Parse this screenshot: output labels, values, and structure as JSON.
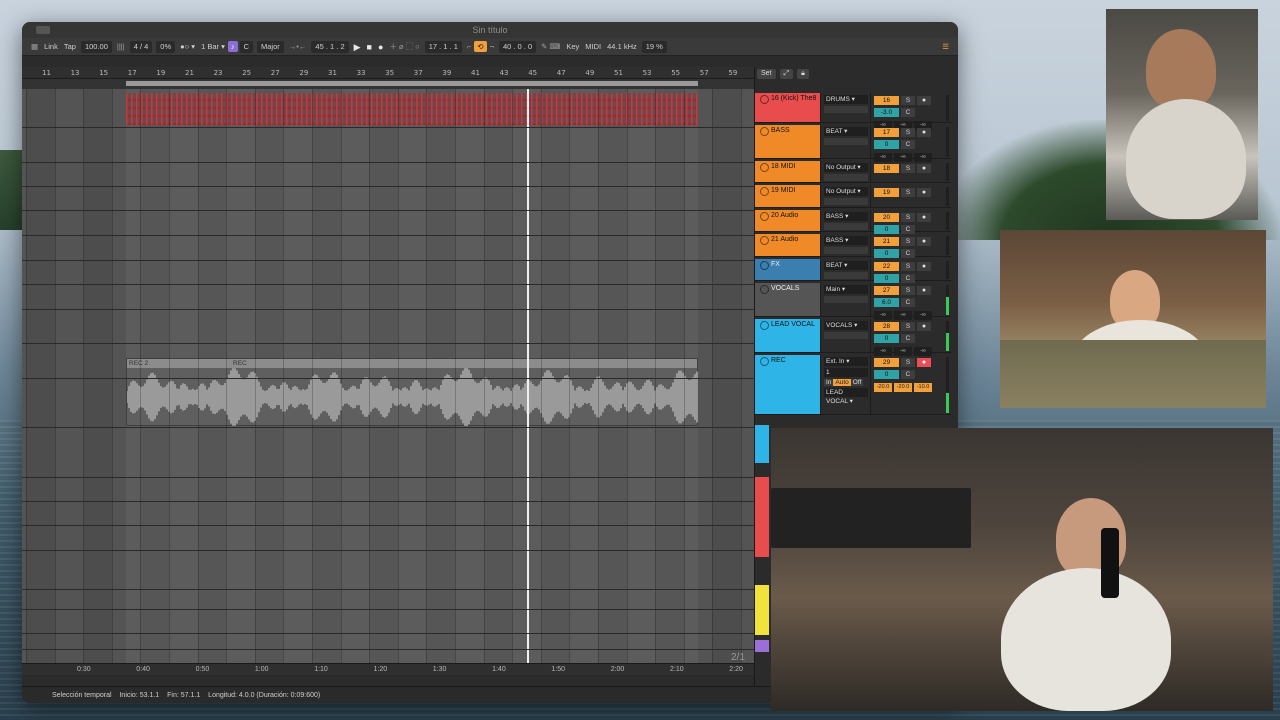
{
  "window": {
    "title": "Sin título"
  },
  "transport": {
    "link": "Link",
    "tap": "Tap",
    "tempo": "100.00",
    "meter_icon": "||||",
    "time_signature": "4 / 4",
    "swing": "0%",
    "metronome": "●○ ▾",
    "quantize": "1 Bar ▾",
    "key_root": "C",
    "scale": "Major",
    "position": "45 .  1 .  2",
    "loop_start": "17 .  1 .  1",
    "loop_length": "40 .  0 .  0",
    "key_label": "Key",
    "midi_label": "MIDI",
    "sample_rate": "44.1 kHz",
    "cpu": "19 %"
  },
  "ruler_ticks": [
    "11",
    "13",
    "15",
    "17",
    "19",
    "21",
    "23",
    "25",
    "27",
    "29",
    "31",
    "33",
    "35",
    "37",
    "39",
    "41",
    "43",
    "45",
    "47",
    "49",
    "51",
    "53",
    "55",
    "57",
    "59"
  ],
  "time_ticks": [
    "0:30",
    "0:40",
    "0:50",
    "1:00",
    "1:10",
    "1:20",
    "1:30",
    "1:40",
    "1:50",
    "2:00",
    "2:10",
    "2:20"
  ],
  "page_indicator": "2/1",
  "clips": {
    "audio_clip_name": "REC 2",
    "audio_clip_name_b": "REC"
  },
  "mixer": {
    "set_label": "Set",
    "tracks": [
      {
        "name": "16 (Kick) The8",
        "color": "#e94c4c",
        "output": "DRUMS",
        "num": "16",
        "vol": "-3.0"
      },
      {
        "name": "BASS",
        "color": "#f08a28",
        "output": "BEAT",
        "num": "17",
        "vol": "0"
      },
      {
        "name": "18 MIDI",
        "color": "#f08a28",
        "output": "No Output",
        "num": "18"
      },
      {
        "name": "19 MIDI",
        "color": "#f08a28",
        "output": "No Output",
        "num": "19"
      },
      {
        "name": "20 Audio",
        "color": "#f08a28",
        "output": "BASS",
        "num": "20",
        "vol": "0"
      },
      {
        "name": "21 Audio",
        "color": "#f08a28",
        "output": "BASS",
        "num": "21",
        "vol": "0"
      },
      {
        "name": "FX",
        "color": "#3a7fb0",
        "output": "BEAT",
        "num": "22",
        "vol": "0"
      },
      {
        "name": "VOCALS",
        "color": "#555555",
        "output": "Main",
        "num": "27",
        "vol": "6.0"
      },
      {
        "name": "LEAD VOCAL",
        "color": "#2fb4e8",
        "output": "VOCALS",
        "num": "28",
        "vol": "0"
      },
      {
        "name": "REC",
        "color": "#2fb4e8",
        "output": "Ext. In",
        "num": "29",
        "vol": "0",
        "input_channel": "1",
        "monitor": [
          "In",
          "Auto",
          "Off"
        ],
        "sends": [
          "-20.0",
          "-20.0",
          "-10.0"
        ],
        "route": "LEAD VOCAL"
      }
    ],
    "pan": "C",
    "solo": "S",
    "inf": "-∞"
  },
  "status": {
    "label": "Selección temporal",
    "start": "Inicio: 53.1.1",
    "end": "Fin: 57.1.1",
    "length": "Longitud: 4.0.0 (Duración: 0:09:600)"
  }
}
